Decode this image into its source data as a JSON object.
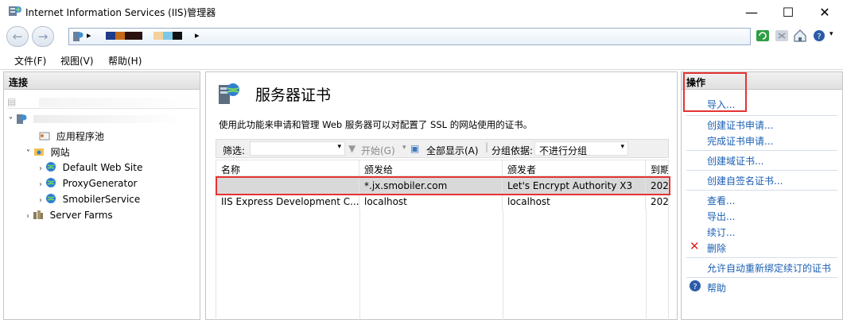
{
  "window": {
    "title": "Internet Information Services (IIS)管理器",
    "minimize_glyph": "—",
    "maximize_glyph": "☐",
    "close_glyph": "✕"
  },
  "address": {
    "separator": "▸",
    "back_glyph": "←",
    "forward_glyph": "→"
  },
  "menu": {
    "file": "文件(F)",
    "view": "视图(V)",
    "help": "帮助(H)"
  },
  "connections": {
    "header": "连接",
    "tree": [
      {
        "label": "应用程序池"
      },
      {
        "label": "网站"
      },
      {
        "label": "Default Web Site"
      },
      {
        "label": "ProxyGenerator"
      },
      {
        "label": "SmobilerService"
      },
      {
        "label": "Server Farms"
      }
    ]
  },
  "main": {
    "title": "服务器证书",
    "description": "使用此功能来申请和管理 Web 服务器可以对配置了 SSL 的网站使用的证书。",
    "toolbar": {
      "filter_label": "筛选:",
      "start_label": "开始(G)",
      "show_all_label": "全部显示(A)",
      "group_by_label": "分组依据:",
      "group_by_value": "不进行分组"
    },
    "columns": [
      "名称",
      "颁发给",
      "颁发者",
      "到期"
    ],
    "rows": [
      {
        "name": "",
        "issued_to": "*.jx.smobiler.com",
        "issuer": "Let's Encrypt Authority X3",
        "expires": "202"
      },
      {
        "name": "IIS Express Development C...",
        "issued_to": "localhost",
        "issuer": "localhost",
        "expires": "202"
      }
    ]
  },
  "actions": {
    "header": "操作",
    "import": "导入...",
    "create_request": "创建证书申请...",
    "complete_request": "完成证书申请...",
    "create_domain_cert": "创建域证书...",
    "create_self_signed": "创建自签名证书...",
    "view": "查看...",
    "export": "导出...",
    "renew": "续订...",
    "delete": "删除",
    "auto_rebind": "允许自动重新绑定续订的证书",
    "help": "帮助"
  },
  "colors": {
    "highlight": "#e53333",
    "link": "#1a5fb4",
    "selected_row": "#d9d9d9"
  }
}
